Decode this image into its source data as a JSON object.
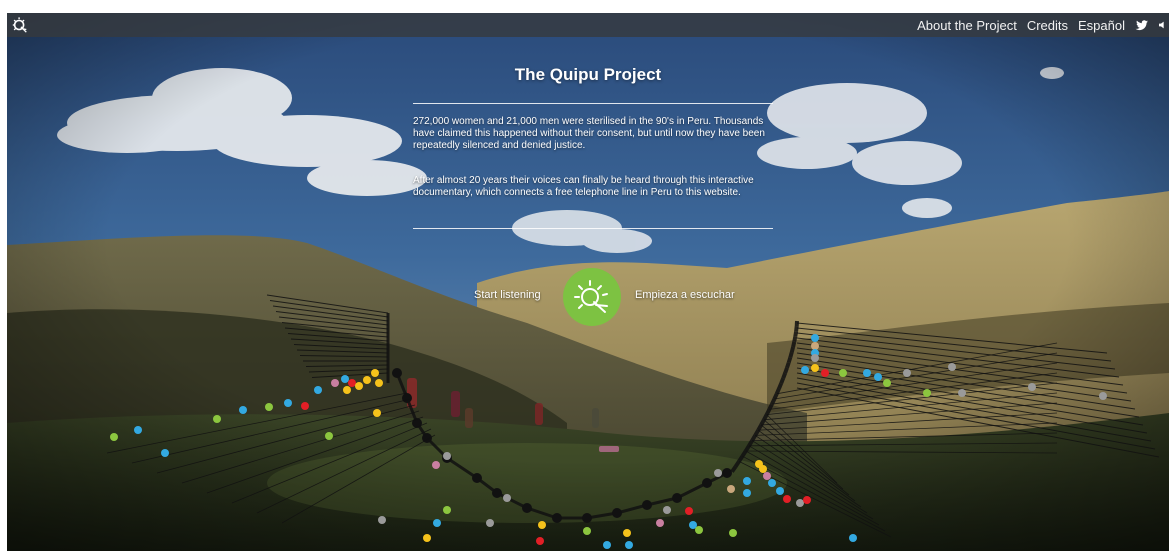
{
  "header": {
    "logo_icon": "quipu-logo-icon",
    "nav": [
      {
        "label": "About the Project"
      },
      {
        "label": "Credits"
      },
      {
        "label": "Español"
      }
    ],
    "social_icons": [
      "twitter-icon",
      "speaker-icon"
    ]
  },
  "intro": {
    "title": "The Quipu Project",
    "paragraph1": "272,000 women and 21,000 men were sterilised in the 90's in Peru. Thousands have claimed this happened without their consent, but until now they have been repeatedly silenced and denied justice.",
    "paragraph2": "After almost 20 years their voices can finally be heard through this interactive documentary, which connects a free telephone line in Peru to this website."
  },
  "actions": {
    "start_en": "Start listening",
    "start_es": "Empieza a escuchar",
    "start_icon": "quipu-sun-icon",
    "button_color": "#7dc242"
  },
  "knot_colors": [
    "#33a9e1",
    "#8cc63f",
    "#e21f26",
    "#f5c21b",
    "#9a9a9a",
    "#c9a77c",
    "#c97fa0",
    "#111111"
  ]
}
